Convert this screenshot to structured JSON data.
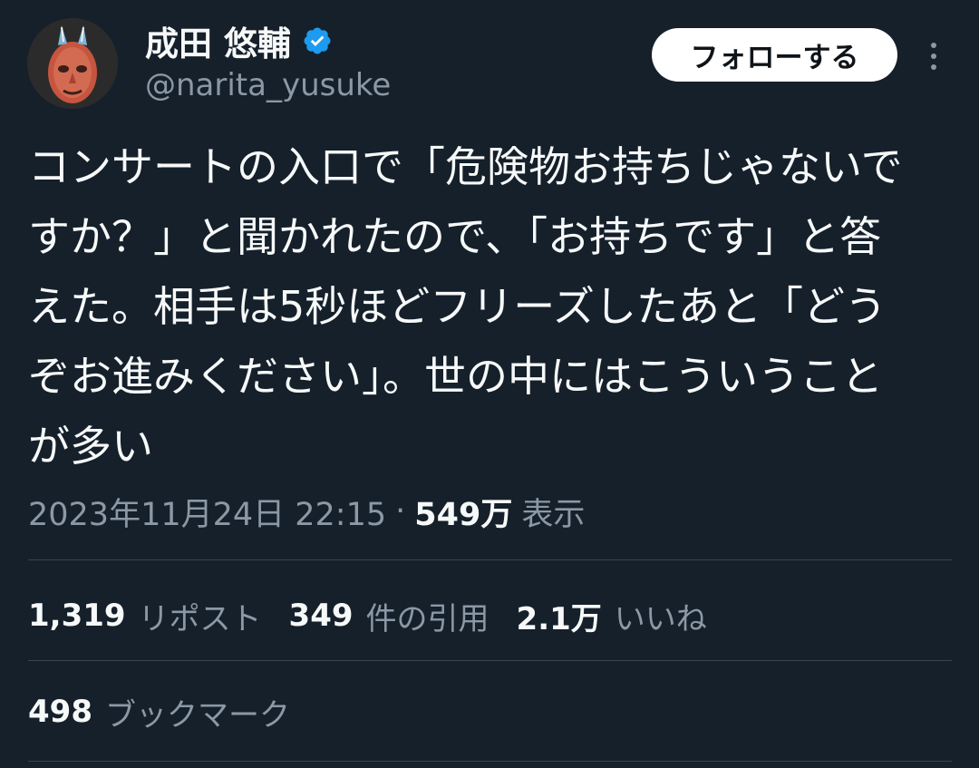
{
  "author": {
    "display_name": "成田 悠輔",
    "handle": "@narita_yusuke",
    "verified": true,
    "avatar_icon": "mask-avatar"
  },
  "header": {
    "follow_label": "フォローする",
    "more_icon": "more-vertical-icon"
  },
  "tweet": {
    "lines": [
      "コンサートの入口で「危険物お持ちじゃないで",
      "すか？」と聞かれたので、「お持ちです」と答",
      "えた。相手は5秒ほどフリーズしたあと「どう",
      "ぞお進みください」。世の中にはこういうこと",
      "が多い"
    ]
  },
  "meta": {
    "timestamp": "2023年11月24日 22:15",
    "separator": "·",
    "views_count": "549万",
    "views_label": "表示"
  },
  "stats": {
    "reposts_count": "1,319",
    "reposts_label": "リポスト",
    "quotes_count": "349",
    "quotes_label": "件の引用",
    "likes_count": "2.1万",
    "likes_label": "いいね"
  },
  "bookmarks": {
    "count": "498",
    "label": "ブックマーク"
  },
  "colors": {
    "background": "#15202b",
    "text_primary": "#f7f9f9",
    "text_secondary": "#8b98a5",
    "verified_blue": "#1d9bf0",
    "divider": "#38444d"
  }
}
